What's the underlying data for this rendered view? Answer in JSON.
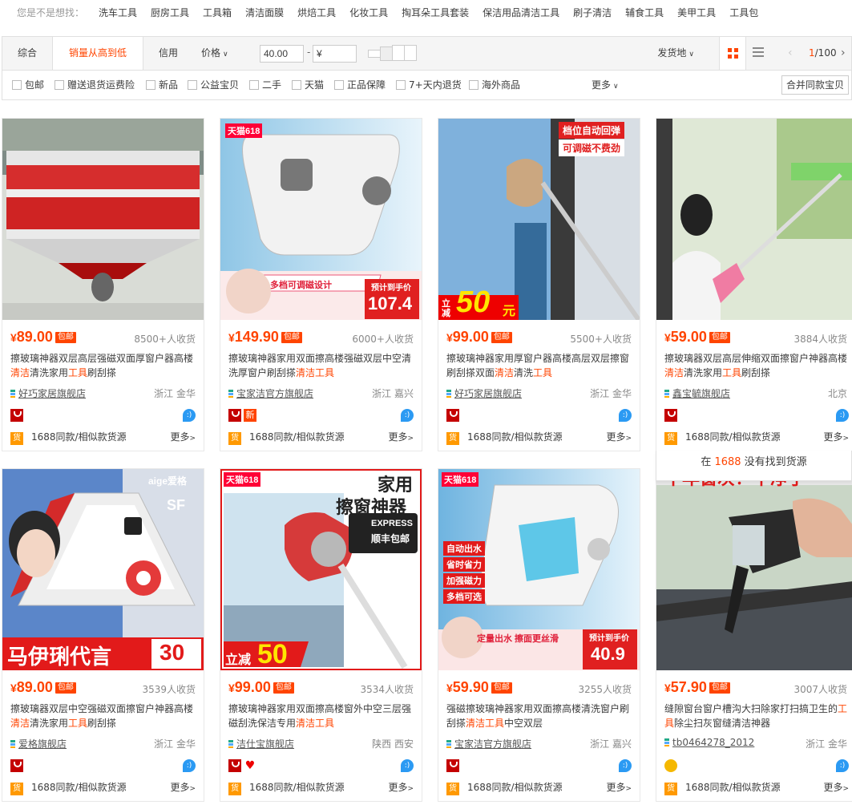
{
  "suggest": {
    "label": "您是不是想找：",
    "items": [
      "洗车工具",
      "厨房工具",
      "工具箱",
      "清洁面膜",
      "烘焙工具",
      "化妆工具",
      "掏耳朵工具套装",
      "保洁用品清洁工具",
      "刷子清洁",
      "辅食工具",
      "美甲工具",
      "工具包"
    ]
  },
  "sortbar": {
    "tabs": [
      "综合",
      "销量从高到低",
      "信用",
      "价格"
    ],
    "active_index": 1,
    "price_min": "40.00",
    "price_max_placeholder": "¥",
    "dash": "-",
    "ship_from": "发货地",
    "page_current": "1",
    "page_total": "/100",
    "prev": "‹",
    "next": "›"
  },
  "filters": {
    "items": [
      "包邮",
      "赠送退货运费险",
      "新品",
      "公益宝贝",
      "二手",
      "天猫",
      "正品保障",
      "7+天内退货",
      "海外商品"
    ],
    "more": "更多",
    "merge_button": "合并同款宝贝"
  },
  "colors": {
    "accent": "#ff4400",
    "text": "#3c3c3c",
    "muted": "#888888"
  },
  "products": [
    {
      "price": "89.00",
      "currency": "¥",
      "free": "包邮",
      "sold": "8500+人收货",
      "title_parts": [
        "擦玻璃神器双层高层强磁双面厚窗户器高楼",
        "清洁",
        "清洗家用",
        "工具",
        "刷刮搽"
      ],
      "shop": "好巧家居旗舰店",
      "loc": "浙江 金华",
      "badges": [
        "tmall"
      ],
      "source": "1688同款/相似款货源",
      "more": "更多",
      "huo": "货"
    },
    {
      "price": "149.90",
      "currency": "¥",
      "free": "包邮",
      "sold": "6000+人收货",
      "title_parts": [
        "擦玻璃神器家用双面擦高楼强磁双层中空清洗厚窗户刷刮搽",
        "清洁",
        "",
        "工具",
        ""
      ],
      "shop": "宝家洁官方旗舰店",
      "loc": "浙江 嘉兴",
      "badges": [
        "tmall",
        "new"
      ],
      "source": "1688同款/相似款货源",
      "more": "更多",
      "huo": "货"
    },
    {
      "price": "99.00",
      "currency": "¥",
      "free": "包邮",
      "sold": "5500+人收货",
      "title_parts": [
        "擦玻璃神器家用厚窗户器高楼高层双层擦窗刷刮搽双面",
        "清洁",
        "清洗",
        "工具",
        ""
      ],
      "shop": "好巧家居旗舰店",
      "loc": "浙江 金华",
      "badges": [
        "tmall"
      ],
      "source": "1688同款/相似款货源",
      "more": "更多",
      "huo": "货"
    },
    {
      "price": "59.00",
      "currency": "¥",
      "free": "包邮",
      "sold": "3884人收货",
      "title_parts": [
        "擦玻璃器双层高层伸缩双面擦窗户神器高楼",
        "清洁",
        "清洗家用",
        "工具",
        "刷刮搽"
      ],
      "shop": "鑫宝毓旗舰店",
      "loc": "北京",
      "badges": [
        "tmall"
      ],
      "source": "1688同款/相似款货源",
      "more": "更多",
      "huo": "货"
    },
    {
      "price": "89.00",
      "currency": "¥",
      "free": "包邮",
      "sold": "3539人收货",
      "title_parts": [
        "擦玻璃器双层中空强磁双面擦窗户神器高楼",
        "清洁",
        "清洗家用",
        "工具",
        "刷刮搽"
      ],
      "shop": "爱格旗舰店",
      "loc": "浙江 金华",
      "badges": [
        "tmall"
      ],
      "source": "1688同款/相似款货源",
      "more": "更多",
      "huo": "货"
    },
    {
      "price": "99.00",
      "currency": "¥",
      "free": "包邮",
      "sold": "3534人收货",
      "title_parts": [
        "擦玻璃神器家用双面擦高楼窗外中空三层强磁刮洗保洁专用",
        "清洁",
        "",
        "工具",
        ""
      ],
      "shop": "洁仕宝旗舰店",
      "loc": "陕西 西安",
      "badges": [
        "tmall",
        "heart"
      ],
      "source": "1688同款/相似款货源",
      "more": "更多",
      "huo": "货"
    },
    {
      "price": "59.90",
      "currency": "¥",
      "free": "包邮",
      "sold": "3255人收货",
      "title_parts": [
        "强磁擦玻璃神器家用双面擦高楼清洗窗户刷刮搽",
        "清洁",
        "",
        "工具",
        "中空双层"
      ],
      "shop": "宝家洁官方旗舰店",
      "loc": "浙江 嘉兴",
      "badges": [
        "tmall"
      ],
      "source": "1688同款/相似款货源",
      "more": "更多",
      "huo": "货"
    },
    {
      "price": "57.90",
      "currency": "¥",
      "free": "包邮",
      "sold": "3007人收货",
      "title_parts": [
        "缝隙窗台窗户槽沟大扫除家打扫搞卫生的",
        "工",
        "",
        "具",
        "除尘扫灰窗缝清洁神器"
      ],
      "shop": "tb0464278_2012",
      "loc": "浙江 金华",
      "badges": [
        "gold"
      ],
      "source": "1688同款/相似款货源",
      "more": "更多",
      "huo": "货"
    }
  ],
  "image_text": {
    "p2_tag": "天猫618",
    "p2_mid": "多档可调磁设计",
    "p2_price_lbl": "预计到手价",
    "p2_price": "107.4",
    "p3_top1": "档位自动回弹",
    "p3_top2": "可调磁不费劲",
    "p3_cut": "立减",
    "p3_amt": "50",
    "p3_unit": "元",
    "p5_brand": "aige爱格",
    "p5_sf": "SF",
    "p5_bottom": "马伊琍代言",
    "p5_amt": "30",
    "p6_tag": "天猫618",
    "p6_h1": "家用",
    "p6_h2": "擦窗神器",
    "p6_exp": "EXPRESS",
    "p6_free": "顺丰包邮",
    "p6_cut": "立减",
    "p6_amt": "50",
    "p7_tag": "天猫618",
    "p7_f1": "自动出水",
    "p7_f2": "省时省力",
    "p7_f3": "加强磁力",
    "p7_f4": "多档可选",
    "p7_mid": "定量出水 擦面更丝滑",
    "p7_price_lbl": "预计到手价",
    "p7_price": "40.9",
    "p8_top": "十年窗灰！千净了"
  },
  "popup": {
    "pre": "在 ",
    "hl": "1688",
    "post": " 没有找到货源"
  }
}
